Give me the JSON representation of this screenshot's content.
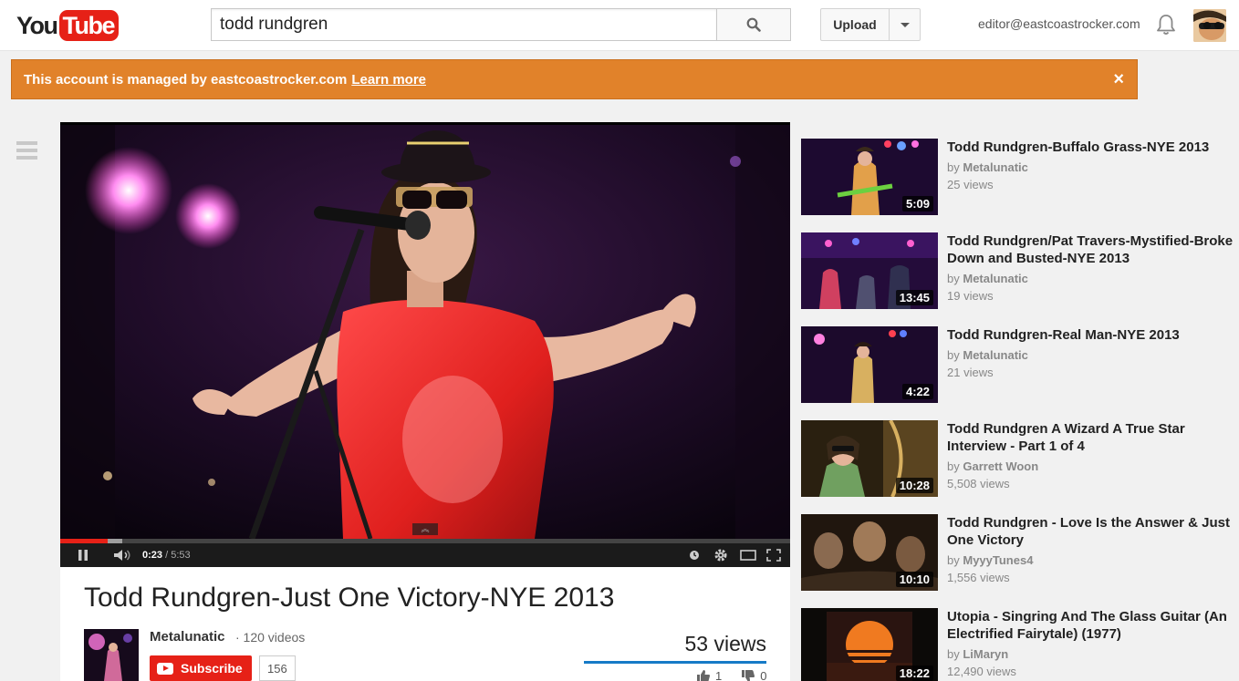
{
  "header": {
    "logo_you": "You",
    "logo_tube": "Tube",
    "search_value": "todd rundgren",
    "upload_label": "Upload",
    "account_email": "editor@eastcoastrocker.com"
  },
  "banner": {
    "text": "This account is managed by eastcoastrocker.com",
    "link": "Learn more",
    "close": "×"
  },
  "player": {
    "time_current": "0:23",
    "time_separator": " / ",
    "time_total": "5:53",
    "progress_played": 0.065,
    "progress_buffered": 0.085
  },
  "video": {
    "title": "Todd Rundgren-Just One Victory-NYE 2013",
    "channel": "Metalunatic",
    "video_count": "· 120 videos",
    "subscribe_label": "Subscribe",
    "subscriber_count": "156",
    "views": "53 views",
    "likes": "1",
    "dislikes": "0"
  },
  "related": [
    {
      "title": "Todd Rundgren-Buffalo Grass-NYE 2013",
      "by": "by",
      "channel": "Metalunatic",
      "views": "25 views",
      "duration": "5:09"
    },
    {
      "title": "Todd Rundgren/Pat Travers-Mystified-Broke Down and Busted-NYE 2013",
      "by": "by",
      "channel": "Metalunatic",
      "views": "19 views",
      "duration": "13:45"
    },
    {
      "title": "Todd Rundgren-Real Man-NYE 2013",
      "by": "by",
      "channel": "Metalunatic",
      "views": "21 views",
      "duration": "4:22"
    },
    {
      "title": "Todd Rundgren A Wizard A True Star Interview - Part 1 of 4",
      "by": "by",
      "channel": "Garrett Woon",
      "views": "5,508 views",
      "duration": "10:28"
    },
    {
      "title": "Todd Rundgren - Love Is the Answer & Just One Victory",
      "by": "by",
      "channel": "MyyyTunes4",
      "views": "1,556 views",
      "duration": "10:10"
    },
    {
      "title": "Utopia - Singring And The Glass Guitar (An Electrified Fairytale) (1977)",
      "by": "by",
      "channel": "LiMaryn",
      "views": "12,490 views",
      "duration": "18:22"
    }
  ],
  "colors": {
    "brand_red": "#e62117",
    "banner_orange": "#e1822a",
    "link_blue": "#167ac6"
  },
  "icons": [
    "search-icon",
    "caret-down-icon",
    "bell-icon",
    "guide-menu-icon",
    "pause-icon",
    "volume-icon",
    "clock-icon",
    "gear-icon",
    "theater-icon",
    "fullscreen-icon",
    "like-icon",
    "dislike-icon",
    "close-icon"
  ]
}
